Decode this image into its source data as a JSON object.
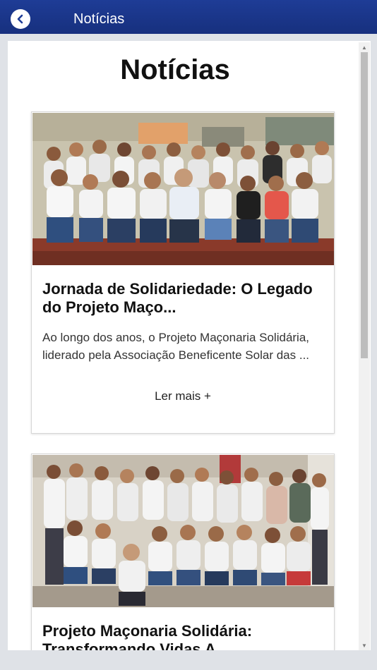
{
  "header": {
    "title": "Notícias",
    "back_icon": "chevron-left-icon",
    "bar_color": "#1e3c96"
  },
  "page": {
    "heading": "Notícias"
  },
  "articles": [
    {
      "title": "Jornada de Solidariedade: O Legado do Projeto Maço...",
      "excerpt": "Ao longo dos anos, o Projeto Maçonaria Solidária, liderado pela Associação Beneficente Solar das ...",
      "read_more": "Ler mais +"
    },
    {
      "title": "Projeto Maçonaria Solidária: Transformando Vidas A..."
    }
  ],
  "scrollbar": {
    "up_icon": "arrow-up-icon",
    "down_icon": "arrow-down-icon"
  }
}
